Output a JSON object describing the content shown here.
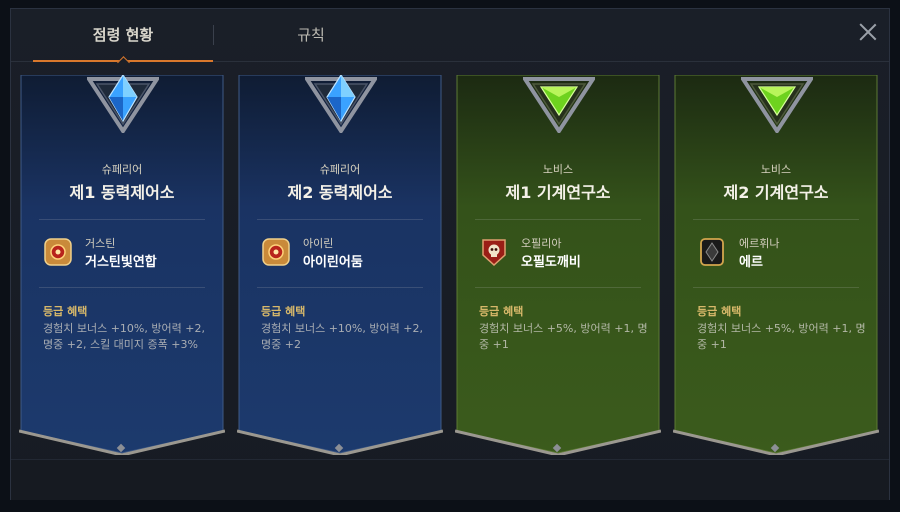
{
  "tabs": {
    "status_label": "점령 현황",
    "rules_label": "규칙"
  },
  "colors": {
    "accent": "#d9782c",
    "superior_bg": "#1d3866",
    "novice_bg": "#3a5a1c",
    "benefit_title": "#d7b86a"
  },
  "cards": [
    {
      "grade": "슈페리어",
      "name": "제1 동력제어소",
      "guild_sub": "거스틴",
      "guild_name": "거스틴빛연합",
      "emblem_icon": "sun-shield-icon",
      "benefit_title": "등급 혜택",
      "benefit_text": "경험치 보너스 +10%, 방어력 +2, 명중 +2, 스킬 대미지 증폭 +3%"
    },
    {
      "grade": "슈페리어",
      "name": "제2 동력제어소",
      "guild_sub": "아이린",
      "guild_name": "아이린어둠",
      "emblem_icon": "sun-shield-icon",
      "benefit_title": "등급 혜택",
      "benefit_text": "경험치 보너스 +10%, 방어력 +2, 명중 +2"
    },
    {
      "grade": "노비스",
      "name": "제1 기계연구소",
      "guild_sub": "오필리아",
      "guild_name": "오필도깨비",
      "emblem_icon": "skull-shield-icon",
      "benefit_title": "등급 혜택",
      "benefit_text": "경험치 보너스 +5%, 방어력 +1, 명중 +1"
    },
    {
      "grade": "노비스",
      "name": "제2 기계연구소",
      "guild_sub": "에르휘나",
      "guild_name": "에르",
      "emblem_icon": "dark-gem-icon",
      "benefit_title": "등급 혜택",
      "benefit_text": "경험치 보너스 +5%, 방어력 +1, 명중 +1"
    }
  ]
}
